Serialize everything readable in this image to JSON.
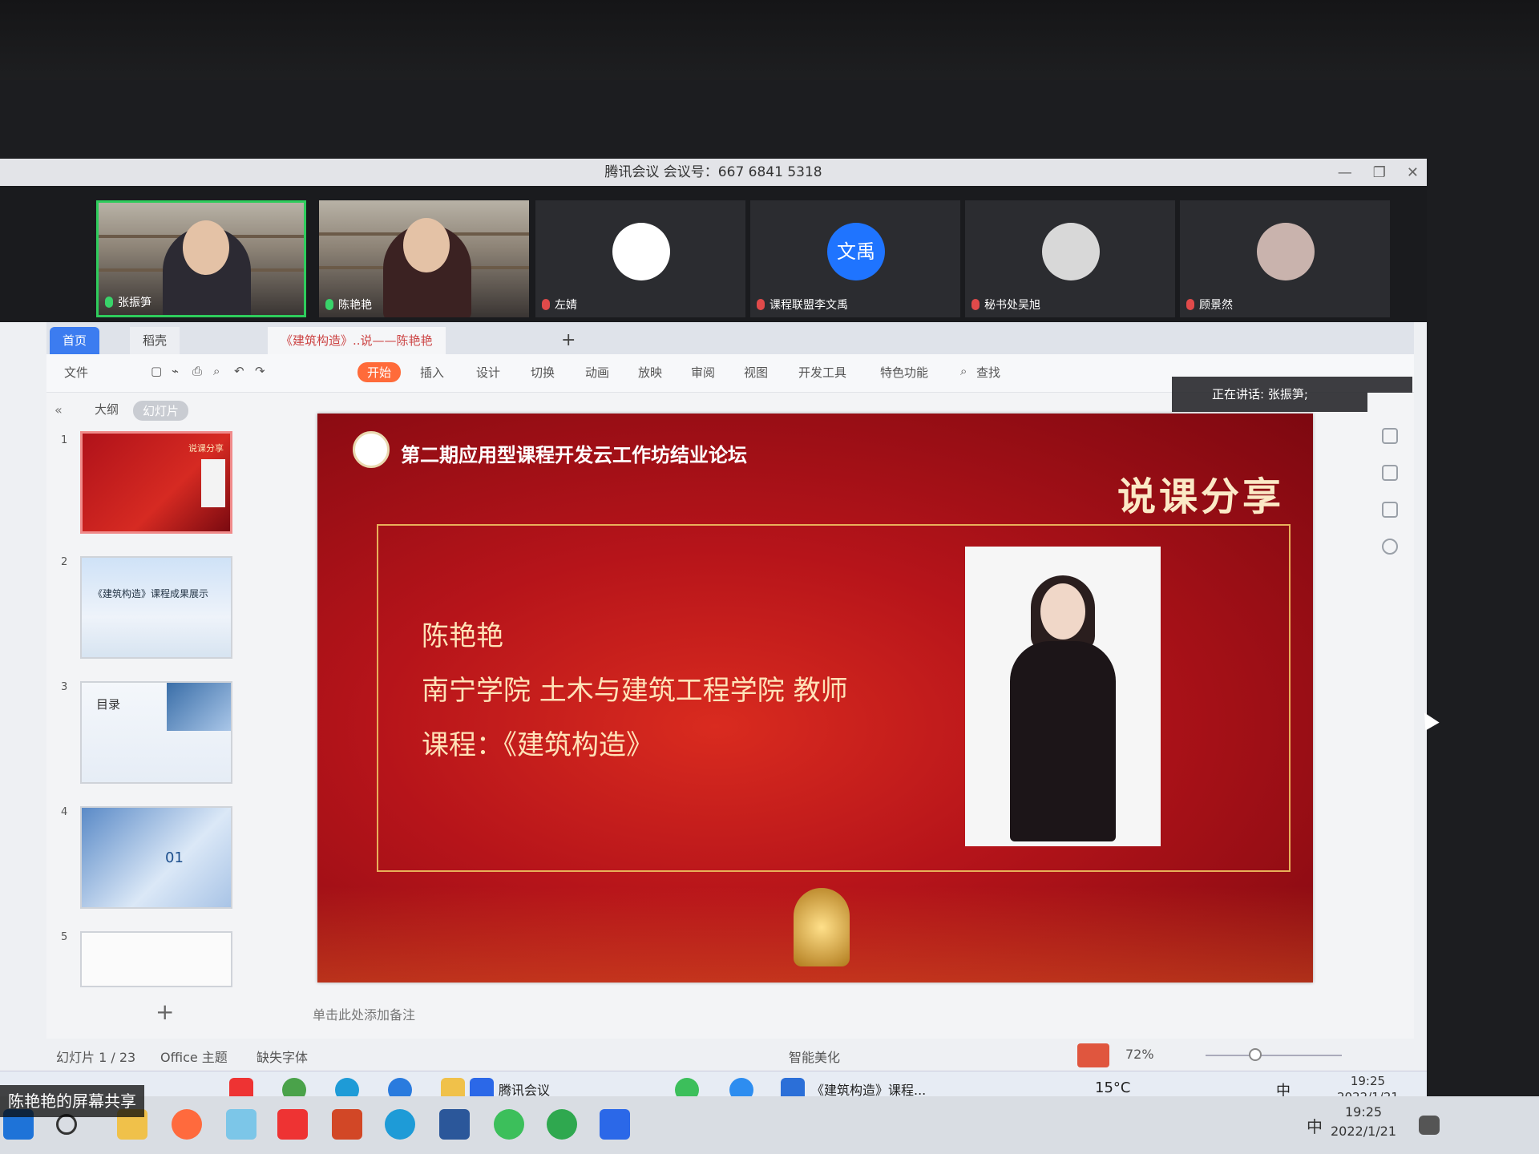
{
  "meeting": {
    "title": "腾讯会议 会议号：667 6841 5318",
    "participants": [
      {
        "name": "张振笋",
        "mic": "on"
      },
      {
        "name": "陈艳艳",
        "mic": "on"
      },
      {
        "name": "左婧",
        "mic": "off"
      },
      {
        "name": "课程联盟李文禹",
        "mic": "off",
        "avatar_text": "文禹"
      },
      {
        "name": "秘书处吴旭",
        "mic": "off"
      },
      {
        "name": "顾景然",
        "mic": "off"
      }
    ],
    "speaking": "正在讲话: 张振笋;",
    "share_label": "陈艳艳的屏幕共享"
  },
  "wps": {
    "tabs": {
      "home": "首页",
      "docer": "稻壳",
      "doc": "《建筑构造》..说——陈艳艳"
    },
    "menu": {
      "file": "文件",
      "start": "开始",
      "insert": "插入",
      "design": "设计",
      "transition": "切换",
      "animation": "动画",
      "slideshow": "放映",
      "review": "审阅",
      "view": "视图",
      "devtools": "开发工具",
      "features": "特色功能",
      "search": "查找"
    },
    "side_tabs": {
      "outline": "大纲",
      "slides": "幻灯片"
    },
    "thumbs": [
      {
        "num": "1",
        "caption": "说课分享"
      },
      {
        "num": "2",
        "caption": "《建筑构造》课程成果展示"
      },
      {
        "num": "3",
        "caption": "目录"
      },
      {
        "num": "4",
        "caption": "01"
      },
      {
        "num": "5",
        "caption": ""
      }
    ],
    "notes_placeholder": "单击此处添加备注",
    "status": {
      "slide": "幻灯片 1 / 23",
      "theme": "Office 主题",
      "font": "缺失字体",
      "beautify": "智能美化",
      "zoom": "72%"
    }
  },
  "slide": {
    "forum": "第二期应用型课程开发云工作坊结业论坛",
    "headline": "说课分享",
    "name": "陈艳艳",
    "org": "南宁学院  土木与建筑工程学院  教师",
    "course": "课程：《建筑构造》"
  },
  "inner_taskbar": {
    "meeting": "腾讯会议",
    "wps": "《建筑构造》课程...",
    "weather": "15°C",
    "time": "19:25",
    "date": "2022/1/21",
    "ime": "中"
  },
  "outer_taskbar": {
    "time": "19:25",
    "date": "2022/1/21",
    "ime": "中"
  }
}
